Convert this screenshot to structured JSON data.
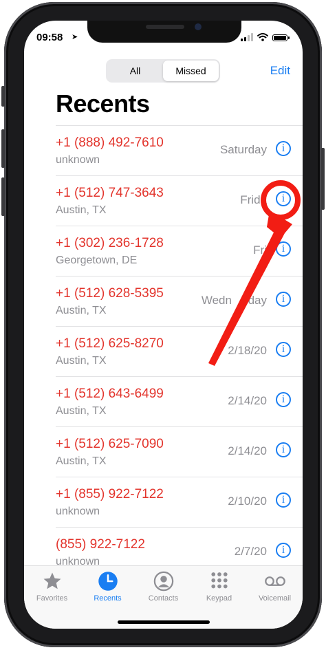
{
  "status": {
    "time": "09:58"
  },
  "segmented": {
    "all": "All",
    "missed": "Missed"
  },
  "header": {
    "edit": "Edit",
    "title": "Recents"
  },
  "calls": [
    {
      "number": "+1 (888) 492-7610",
      "location": "unknown",
      "date": "Saturday"
    },
    {
      "number": "+1 (512) 747-3643",
      "location": "Austin, TX",
      "date": "Frida"
    },
    {
      "number": "+1 (302) 236-1728",
      "location": "Georgetown, DE",
      "date": "Fri"
    },
    {
      "number": "+1 (512) 628-5395",
      "location": "Austin, TX",
      "date": "Wedn     day"
    },
    {
      "number": "+1 (512) 625-8270",
      "location": "Austin, TX",
      "date": "2/18/20"
    },
    {
      "number": "+1 (512) 643-6499",
      "location": "Austin, TX",
      "date": "2/14/20"
    },
    {
      "number": "+1 (512) 625-7090",
      "location": "Austin, TX",
      "date": "2/14/20"
    },
    {
      "number": "+1 (855) 922-7122",
      "location": "unknown",
      "date": "2/10/20"
    },
    {
      "number": "(855) 922-7122",
      "location": "unknown",
      "date": "2/7/20"
    }
  ],
  "tabs": {
    "favorites": "Favorites",
    "recents": "Recents",
    "contacts": "Contacts",
    "keypad": "Keypad",
    "voicemail": "Voicemail"
  },
  "colors": {
    "accent": "#1a7ef2",
    "missed": "#e3352d",
    "annotation": "#f21d14"
  }
}
